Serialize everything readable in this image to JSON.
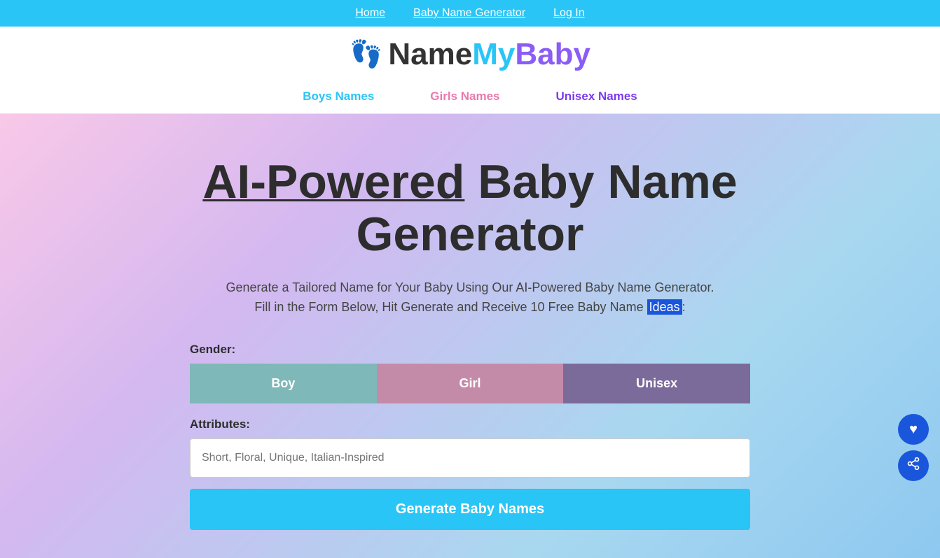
{
  "topNav": {
    "links": [
      {
        "label": "Home",
        "id": "home"
      },
      {
        "label": "Baby Name Generator",
        "id": "generator"
      },
      {
        "label": "Log In",
        "id": "login"
      }
    ]
  },
  "logo": {
    "icon": "👣",
    "name": "Name",
    "my": "My",
    "baby": "Baby"
  },
  "secNav": {
    "links": [
      {
        "label": "Boys Names",
        "class": "boys"
      },
      {
        "label": "Girls Names",
        "class": "girls"
      },
      {
        "label": "Unisex Names",
        "class": "unisex"
      }
    ]
  },
  "hero": {
    "title_part1": "AI-Powered",
    "title_part2": "Baby Name Generator",
    "subtitle_line1": "Generate a Tailored Name for Your Baby Using Our AI-Powered Baby Name Generator.",
    "subtitle_line2": "Fill in the Form Below, Hit Generate and Receive 10 Free Baby Name ",
    "subtitle_highlight": "Ideas",
    "subtitle_end": ":",
    "gender_label": "Gender:",
    "gender_buttons": [
      {
        "label": "Boy",
        "class": "boy"
      },
      {
        "label": "Girl",
        "class": "girl"
      },
      {
        "label": "Unisex",
        "class": "unisex"
      }
    ],
    "attributes_label": "Attributes:",
    "attributes_placeholder": "Short, Floral, Unique, Italian-Inspired",
    "generate_button": "Generate Baby Names"
  },
  "floating": {
    "heart_icon": "♥",
    "share_icon": "⤢"
  }
}
